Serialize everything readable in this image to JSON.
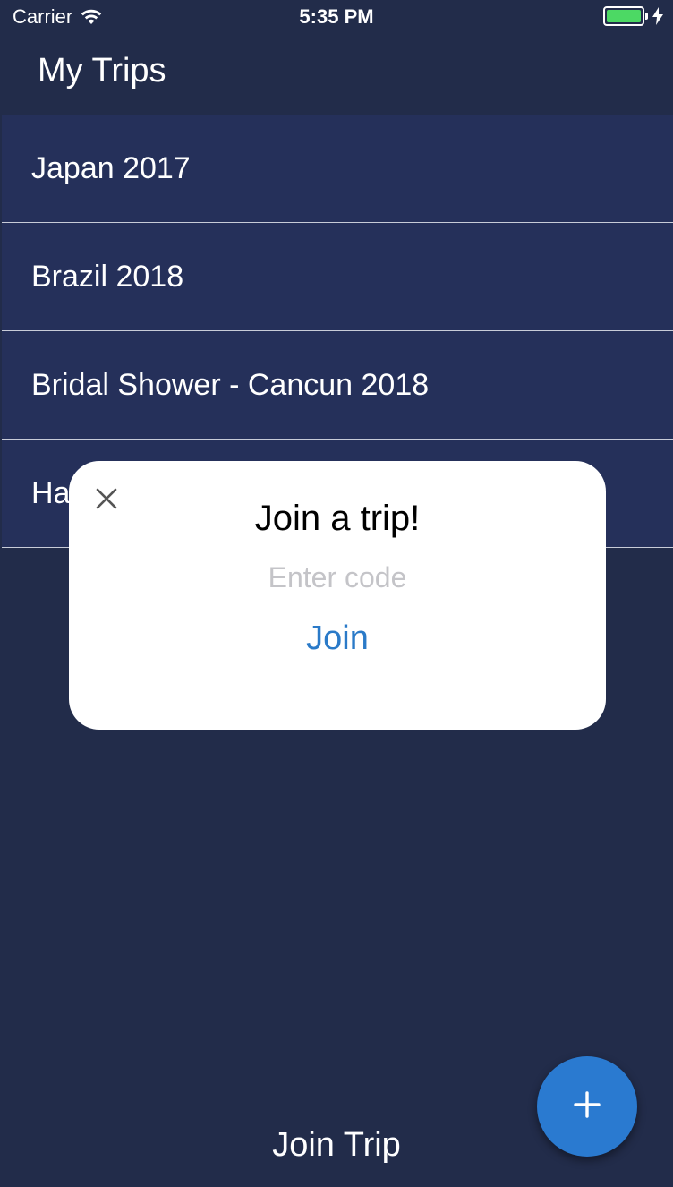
{
  "status_bar": {
    "carrier": "Carrier",
    "time": "5:35 PM",
    "battery_level": 1.0,
    "wifi_icon": "wifi-icon",
    "charging_icon": "bolt-icon"
  },
  "header": {
    "title": "My Trips"
  },
  "trips": [
    {
      "name": "Japan 2017"
    },
    {
      "name": "Brazil 2018"
    },
    {
      "name": "Bridal Shower - Cancun 2018"
    },
    {
      "name": "Ha"
    }
  ],
  "modal": {
    "title": "Join a trip!",
    "code_placeholder": "Enter code",
    "code_value": "",
    "join_label": "Join",
    "close_icon": "close-icon"
  },
  "footer": {
    "join_trip_label": "Join Trip",
    "add_icon": "plus-icon"
  },
  "colors": {
    "background": "#222c4a",
    "list_item": "#25305a",
    "accent": "#2a7ad0",
    "link": "#2a7ac8",
    "battery": "#4cd964"
  }
}
